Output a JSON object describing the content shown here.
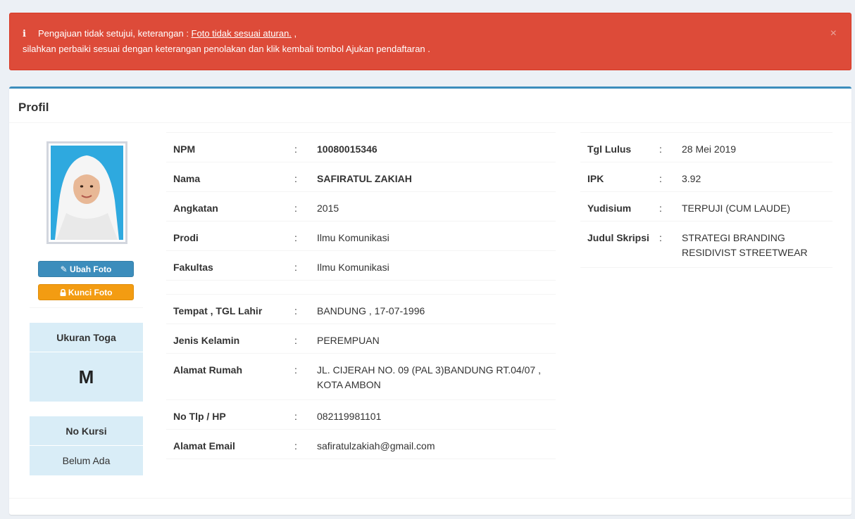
{
  "alert": {
    "line1_prefix": "Pengajuan tidak setujui, keterangan : ",
    "line1_link": "Foto tidak sesuai aturan.",
    "line1_suffix": " ,",
    "line2": "silahkan perbaiki sesuai dengan keterangan penolakan dan klik kembali tombol Ajukan pendaftaran .",
    "close": "×",
    "bg_color": "#dd4b39"
  },
  "profile_box": {
    "title": "Profil",
    "accent_color": "#3c8dbc"
  },
  "photo_actions": {
    "ubah_label": "Ubah Foto",
    "ubah_icon": "edit-icon",
    "kunci_label": "Kunci Foto",
    "kunci_icon": "lock-icon"
  },
  "toga": {
    "label": "Ukuran Toga",
    "value": "M"
  },
  "kursi": {
    "label": "No Kursi",
    "value": "Belum Ada"
  },
  "separator": ":",
  "mid_rows": [
    {
      "label": "NPM",
      "value": "10080015346",
      "bold": true
    },
    {
      "label": "Nama",
      "value": "SAFIRATUL ZAKIAH",
      "bold": true
    },
    {
      "label": "Angkatan",
      "value": "2015"
    },
    {
      "label": "Prodi",
      "value": "Ilmu Komunikasi"
    },
    {
      "label": "Fakultas",
      "value": "Ilmu Komunikasi"
    }
  ],
  "mid_rows_2": [
    {
      "label": "Tempat , TGL Lahir",
      "value": "BANDUNG , 17-07-1996"
    },
    {
      "label": "Jenis Kelamin",
      "value": "PEREMPUAN"
    },
    {
      "label": "Alamat Rumah",
      "value": "JL. CIJERAH NO. 09 (PAL 3)BANDUNG RT.04/07 , KOTA AMBON"
    },
    {
      "label": "No Tlp / HP",
      "value": "082119981101"
    },
    {
      "label": "Alamat Email",
      "value": "safiratulzakiah@gmail.com"
    }
  ],
  "right_rows": [
    {
      "label": "Tgl Lulus",
      "value": "28 Mei 2019"
    },
    {
      "label": "IPK",
      "value": "3.92"
    },
    {
      "label": "Yudisium",
      "value": "TERPUJI (CUM LAUDE)"
    },
    {
      "label": "Judul Skripsi",
      "value": "STRATEGI BRANDING RESIDIVIST STREETWEAR"
    }
  ]
}
